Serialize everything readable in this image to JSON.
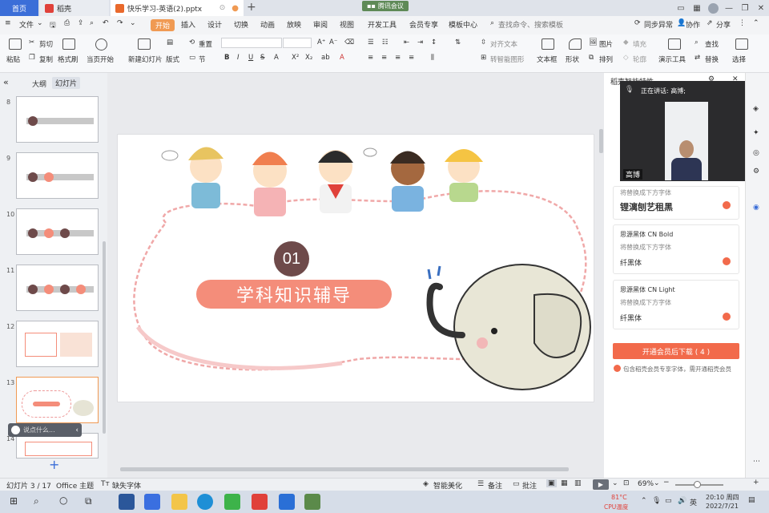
{
  "tabs": {
    "home": "首页",
    "docer": "稻壳",
    "file": "快乐学习-英语(2).pptx",
    "new_tab": "+"
  },
  "meeting": {
    "label": "腾讯会议"
  },
  "menu": {
    "file": "文件",
    "items": [
      "开始",
      "插入",
      "设计",
      "切换",
      "动画",
      "放映",
      "审阅",
      "视图",
      "开发工具",
      "会员专享",
      "模板中心"
    ],
    "search": "查找命令、搜索模板",
    "sync": "同步异常",
    "collab": "协作",
    "share": "分享"
  },
  "ribbon": {
    "cut": "剪切",
    "copy": "复制",
    "format_painter": "格式刷",
    "paste": "粘贴",
    "play_from_current": "当页开始",
    "new_slide": "新建幻灯片",
    "layout": "版式",
    "section": "节",
    "reset": "重置",
    "align_text": "对齐文本",
    "smart_graphic": "转智能图形",
    "textbox": "文本框",
    "shape": "形状",
    "picture": "图片",
    "arrange": "排列",
    "fill": "填充",
    "outline": "轮廓",
    "presenter_tools": "演示工具",
    "find": "查找",
    "replace": "替换",
    "select": "选择"
  },
  "left_panel": {
    "tab_outline": "大纲",
    "tab_slides": "幻灯片",
    "slide_numbers": [
      "8",
      "9",
      "10",
      "11",
      "12",
      "13",
      "14"
    ],
    "add_slide": "+",
    "assistant_hint": "说点什么..."
  },
  "slide": {
    "number": "01",
    "title": "学科知识辅导"
  },
  "right_panel": {
    "header": "稻壳智能特性",
    "speaker": "正在讲话: 高博;",
    "camera_name": "高博",
    "replace_label": "将替换成下方字体",
    "fonts": [
      {
        "name": "",
        "replace": "将替换成下方字体",
        "preview": "锂漓刨艺租黑"
      },
      {
        "name": "思源黑体 CN Bold",
        "replace": "将替换成下方字体",
        "preview": "纤黑体"
      },
      {
        "name": "思源黑体 CN Light",
        "replace": "将替换成下方字体",
        "preview": "纤黑体"
      }
    ],
    "download_button": "开通会员后下载 ( 4 )",
    "member_note": "包含稻壳会员专享字体，需开通稻壳会员"
  },
  "status": {
    "slide_counter": "幻灯片 3 / 17",
    "theme": "Office 主题",
    "missing_font": "缺失字体",
    "smart_beautify": "智能美化",
    "notes": "备注",
    "comments": "批注",
    "zoom": "69%"
  },
  "taskbar": {
    "temp": "81°C",
    "temp_label": "CPU温度",
    "lang": "英",
    "time": "20:10 周四",
    "date": "2022/7/21"
  },
  "colors": {
    "accent": "#3b6ed8",
    "start_tab": "#f09a53",
    "download": "#f26a4b",
    "title_pill": "#f48d7a",
    "circle": "#6e4a4a"
  }
}
